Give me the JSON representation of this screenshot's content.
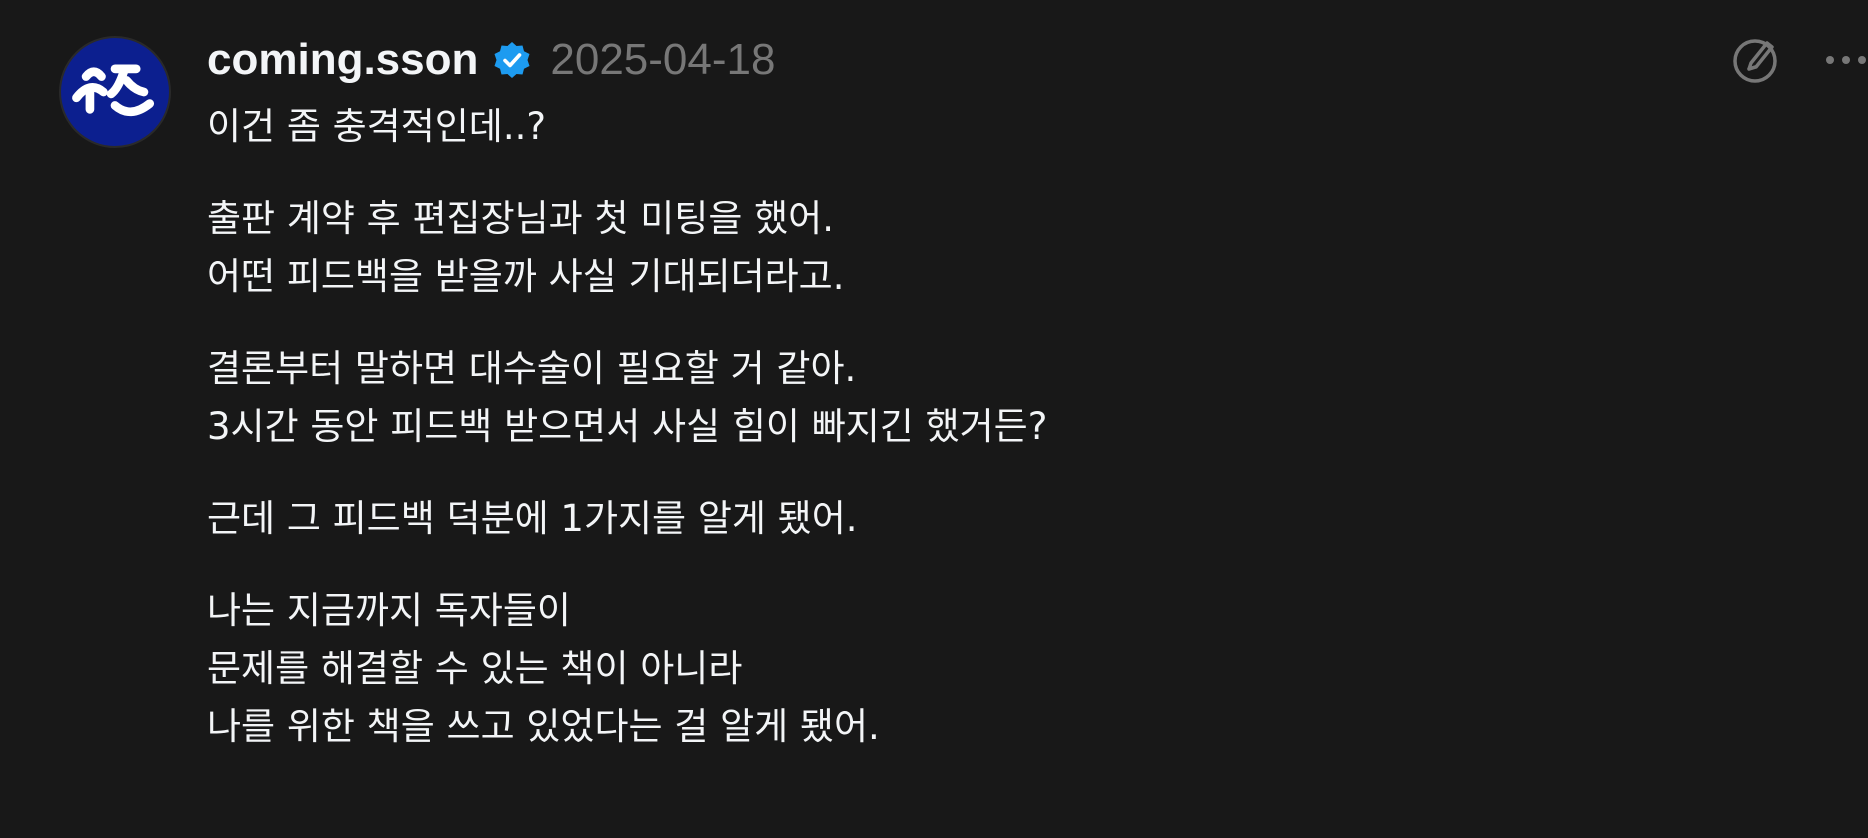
{
  "post": {
    "author": {
      "username": "coming.sson",
      "verified_icon": "verified-badge-icon",
      "avatar_icon": "avatar-image"
    },
    "timestamp": "2025-04-18",
    "actions": {
      "edit_icon": "edit-icon",
      "more_icon": "more-options-icon"
    },
    "paragraphs": [
      {
        "lines": [
          "이건 좀 충격적인데..?"
        ]
      },
      {
        "lines": [
          "출판 계약 후 편집장님과 첫 미팅을 했어.",
          "어떤 피드백을 받을까 사실 기대되더라고."
        ]
      },
      {
        "lines": [
          "결론부터 말하면 대수술이 필요할 거 같아.",
          "3시간 동안 피드백 받으면서 사실 힘이 빠지긴 했거든?"
        ]
      },
      {
        "lines": [
          "근데 그 피드백 덕분에 1가지를 알게 됐어."
        ]
      },
      {
        "lines": [
          "나는 지금까지 독자들이",
          "문제를 해결할 수 있는 책이 아니라",
          "나를 위한 책을 쓰고 있었다는 걸 알게 됐어."
        ]
      }
    ]
  },
  "colors": {
    "background": "#181818",
    "text": "#f3f5f7",
    "muted": "#777777",
    "verified": "#1d9bf0",
    "avatar_bg": "#0c1f8f"
  }
}
